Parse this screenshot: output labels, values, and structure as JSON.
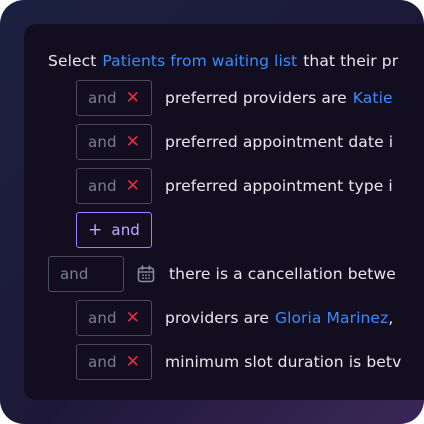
{
  "header": {
    "prefix": "Select",
    "entity": "Patients from waiting list",
    "suffix": "that their pr"
  },
  "conditions": [
    {
      "chip": "and",
      "text": "preferred providers are",
      "link": "Katie"
    },
    {
      "chip": "and",
      "text": "preferred appointment date i",
      "link": ""
    },
    {
      "chip": "and",
      "text": "preferred appointment type i",
      "link": ""
    }
  ],
  "add_button": {
    "plus": "+",
    "label": "and"
  },
  "cancel_row": {
    "chip": "and",
    "text": "there is a cancellation betwe"
  },
  "sub_conditions": [
    {
      "chip": "and",
      "text": "providers are",
      "link": "Gloria Marinez",
      "after": " ,"
    },
    {
      "chip": "and",
      "text": "minimum slot duration is betv",
      "link": "",
      "after": ""
    }
  ],
  "icons": {
    "remove": "x-icon",
    "calendar": "calendar-icon"
  },
  "colors": {
    "accent": "#3b8cff",
    "remove": "#ef2a43",
    "add": "#a47cff"
  }
}
